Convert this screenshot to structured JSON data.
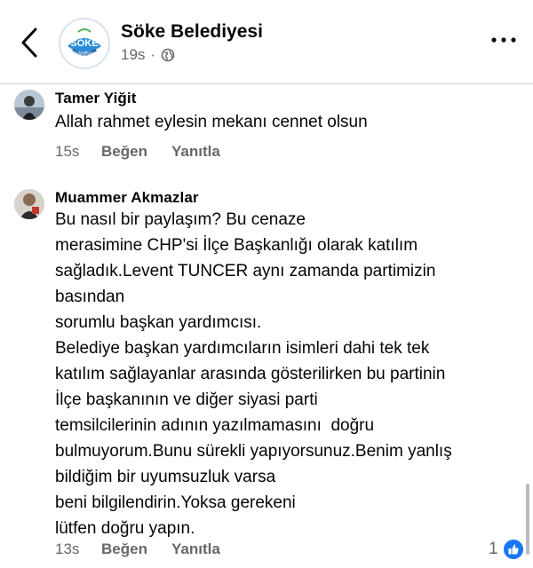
{
  "header": {
    "page_name": "Söke Belediyesi",
    "timestamp": "19s",
    "separator": "·",
    "audience_icon": "globe-icon",
    "logo": {
      "text_top": "SÖKE",
      "text_bottom": "Belediyesi",
      "color": "#2a8dd6"
    }
  },
  "comments": [
    {
      "author": "Tamer Yiğit",
      "lines": [
        "Allah rahmet eylesin mekanı cennet olsun"
      ],
      "time": "15s",
      "like_label": "Beğen",
      "reply_label": "Yanıtla"
    },
    {
      "author": "Muammer Akmazlar",
      "lines": [
        "Bu nasıl bir paylaşım? Bu cenaze",
        "merasimine CHP'si İlçe Başkanlığı olarak katılım",
        "sağladık.Levent TUNCER aynı zamanda partimizin",
        "basından",
        "sorumlu başkan yardımcısı.",
        "Belediye başkan yardımcıların isimleri dahi tek tek",
        "katılım sağlayanlar arasında gösterilirken bu partinin",
        "İlçe başkanının ve diğer siyasi parti",
        "temsilcilerinin adının yazılmamasını  doğru",
        "bulmuyorum.Bunu sürekli yapıyorsunuz.Benim yanlış",
        "bildiğim bir uyumsuzluk varsa",
        "beni bilgilendirin.Yoksa gerekeni",
        "lütfen doğru yapın."
      ],
      "time": "13s",
      "like_label": "Beğen",
      "reply_label": "Yanıtla",
      "reaction_count": "1",
      "reaction_icon": "like-icon"
    }
  ],
  "colors": {
    "accent": "#1877f2",
    "secondary_text": "#65676b",
    "primary_text": "#050505"
  }
}
